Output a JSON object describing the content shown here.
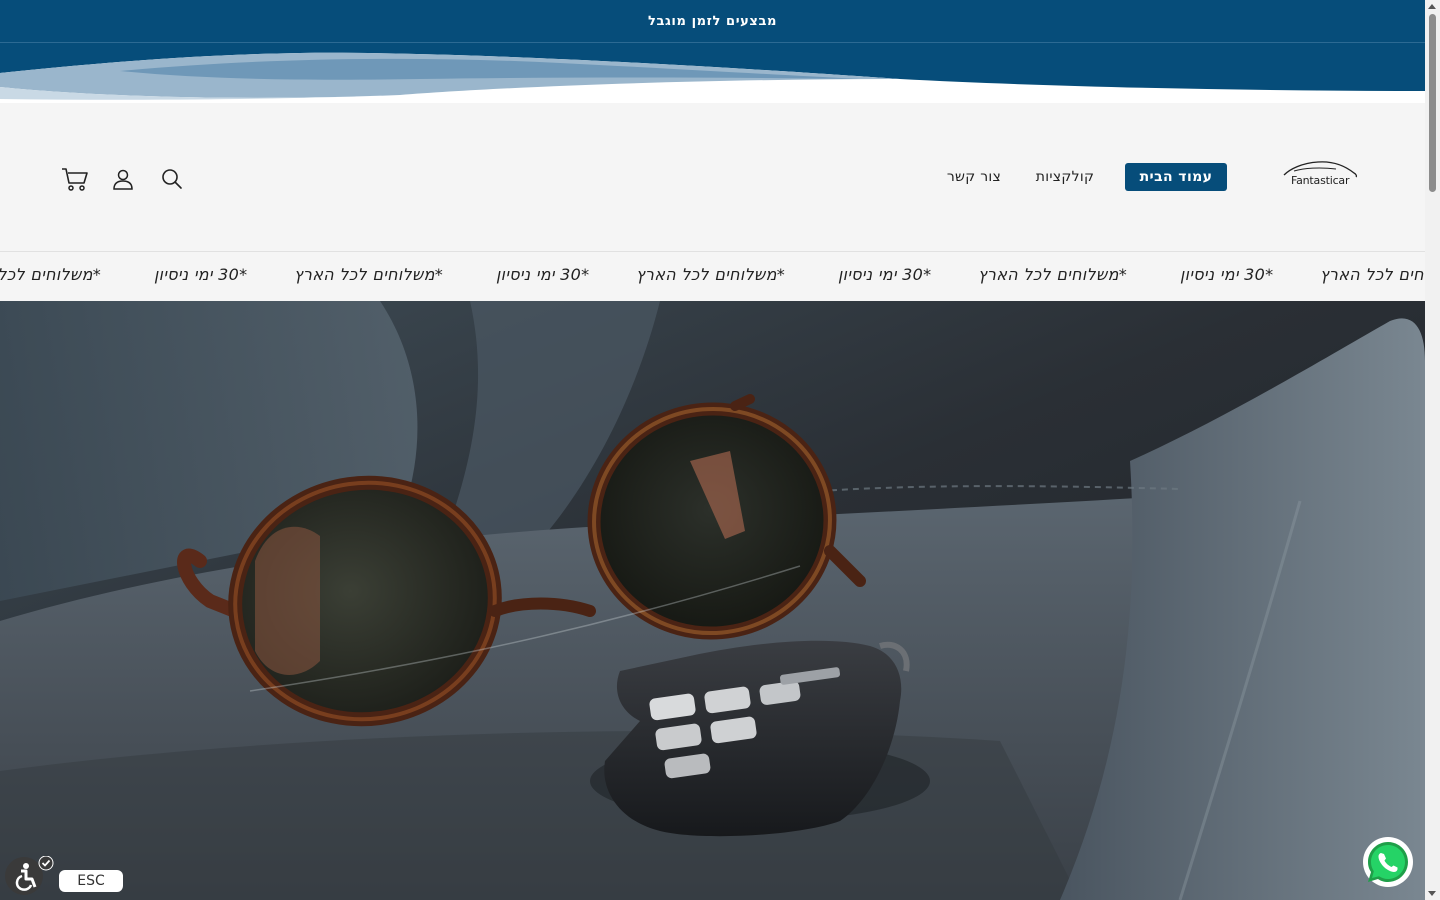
{
  "announcement": {
    "text": "מבצעים לזמן מוגבל"
  },
  "header": {
    "logo_text": "Fantasticar",
    "nav": {
      "home": "עמוד הבית",
      "collections": "קולקציות",
      "contact": "צור קשר"
    },
    "icons": [
      "search-icon",
      "account-icon",
      "cart-icon"
    ]
  },
  "marquee": {
    "items": [
      "*משלוחים לכל הארץ",
      "*30 ימי ניסיון",
      "*משלוחים לכל הארץ",
      "*30 ימי ניסיון",
      "*משלוחים לכל הארץ",
      "*30 ימי ניסיון",
      "*משלוחים לכל הארץ",
      "*30 ימי ניסיון",
      "*משלוחים לכל הארץ"
    ]
  },
  "accessibility": {
    "esc_label": "ESC"
  },
  "colors": {
    "brand": "#064d7a",
    "header_bg": "#f5f5f5"
  }
}
